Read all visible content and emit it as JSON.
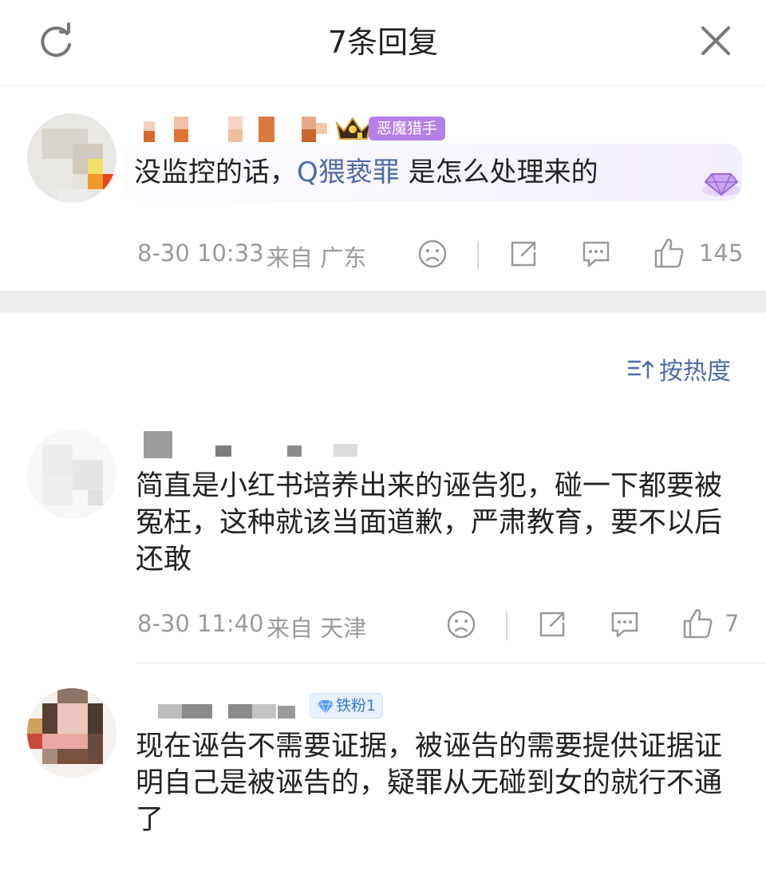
{
  "header": {
    "title": "7条回复"
  },
  "root_comment": {
    "badge_label": "恶魔猎手",
    "text_before": "没监控的话，",
    "keyword": "Q猥亵罪",
    "text_after": " 是怎么处理来的",
    "time": "8-30 10:33",
    "location": "来自 广东",
    "like_count": "145"
  },
  "sort": {
    "label": "按热度"
  },
  "replies": [
    {
      "text": "简直是小红书培养出来的诬告犯，碰一下都要被冤枉，这种就该当面道歉，严肃教育，要不以后还敢",
      "time": "8-30 11:40",
      "location": "来自 天津",
      "like_count": "7"
    },
    {
      "badge_label": "铁粉1",
      "text": "现在诬告不需要证据，被诬告的需要提供证据证明自己是被诬告的，疑罪从无碰到女的就行不通了"
    }
  ],
  "icons": {
    "refresh": "refresh-icon",
    "close": "close-icon",
    "dislike": "sad-face-icon",
    "share": "share-icon",
    "comment": "comment-icon",
    "like": "thumbs-up-icon",
    "sort": "sort-icon",
    "gem": "gem-icon",
    "crown": "crown-icon",
    "diamond": "diamond-icon"
  },
  "colors": {
    "keyword": "#4f6aa8",
    "badge_purple": "#b57fe8",
    "fan_badge_blue": "#3c78d8",
    "meta_gray": "#9a9a9a"
  }
}
